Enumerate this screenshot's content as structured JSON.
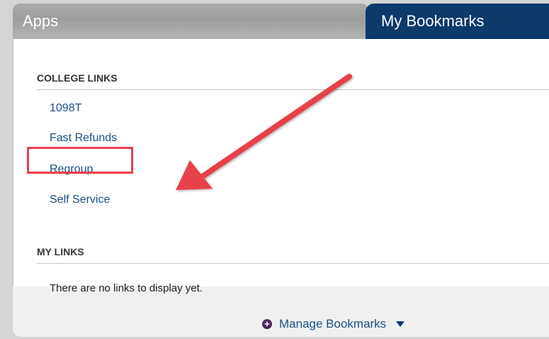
{
  "tabs": [
    {
      "label": "Apps",
      "active": false
    },
    {
      "label": "My Bookmarks",
      "active": true
    }
  ],
  "sections": {
    "college_links": {
      "heading": "COLLEGE LINKS",
      "items": [
        {
          "label": "1098T"
        },
        {
          "label": "Fast Refunds"
        },
        {
          "label": "Regroup"
        },
        {
          "label": "Self Service",
          "highlighted": true
        }
      ]
    },
    "my_links": {
      "heading": "MY LINKS",
      "empty_message": "There are no links to display yet."
    }
  },
  "footer": {
    "manage_label": "Manage Bookmarks",
    "icons": [
      "plus-circle-icon",
      "caret-down-icon"
    ]
  },
  "colors": {
    "active_tab": "#0b3a6b",
    "inactive_tab": "#a9a9a9",
    "link": "#1b4f86",
    "annotation": "#e8404a"
  }
}
